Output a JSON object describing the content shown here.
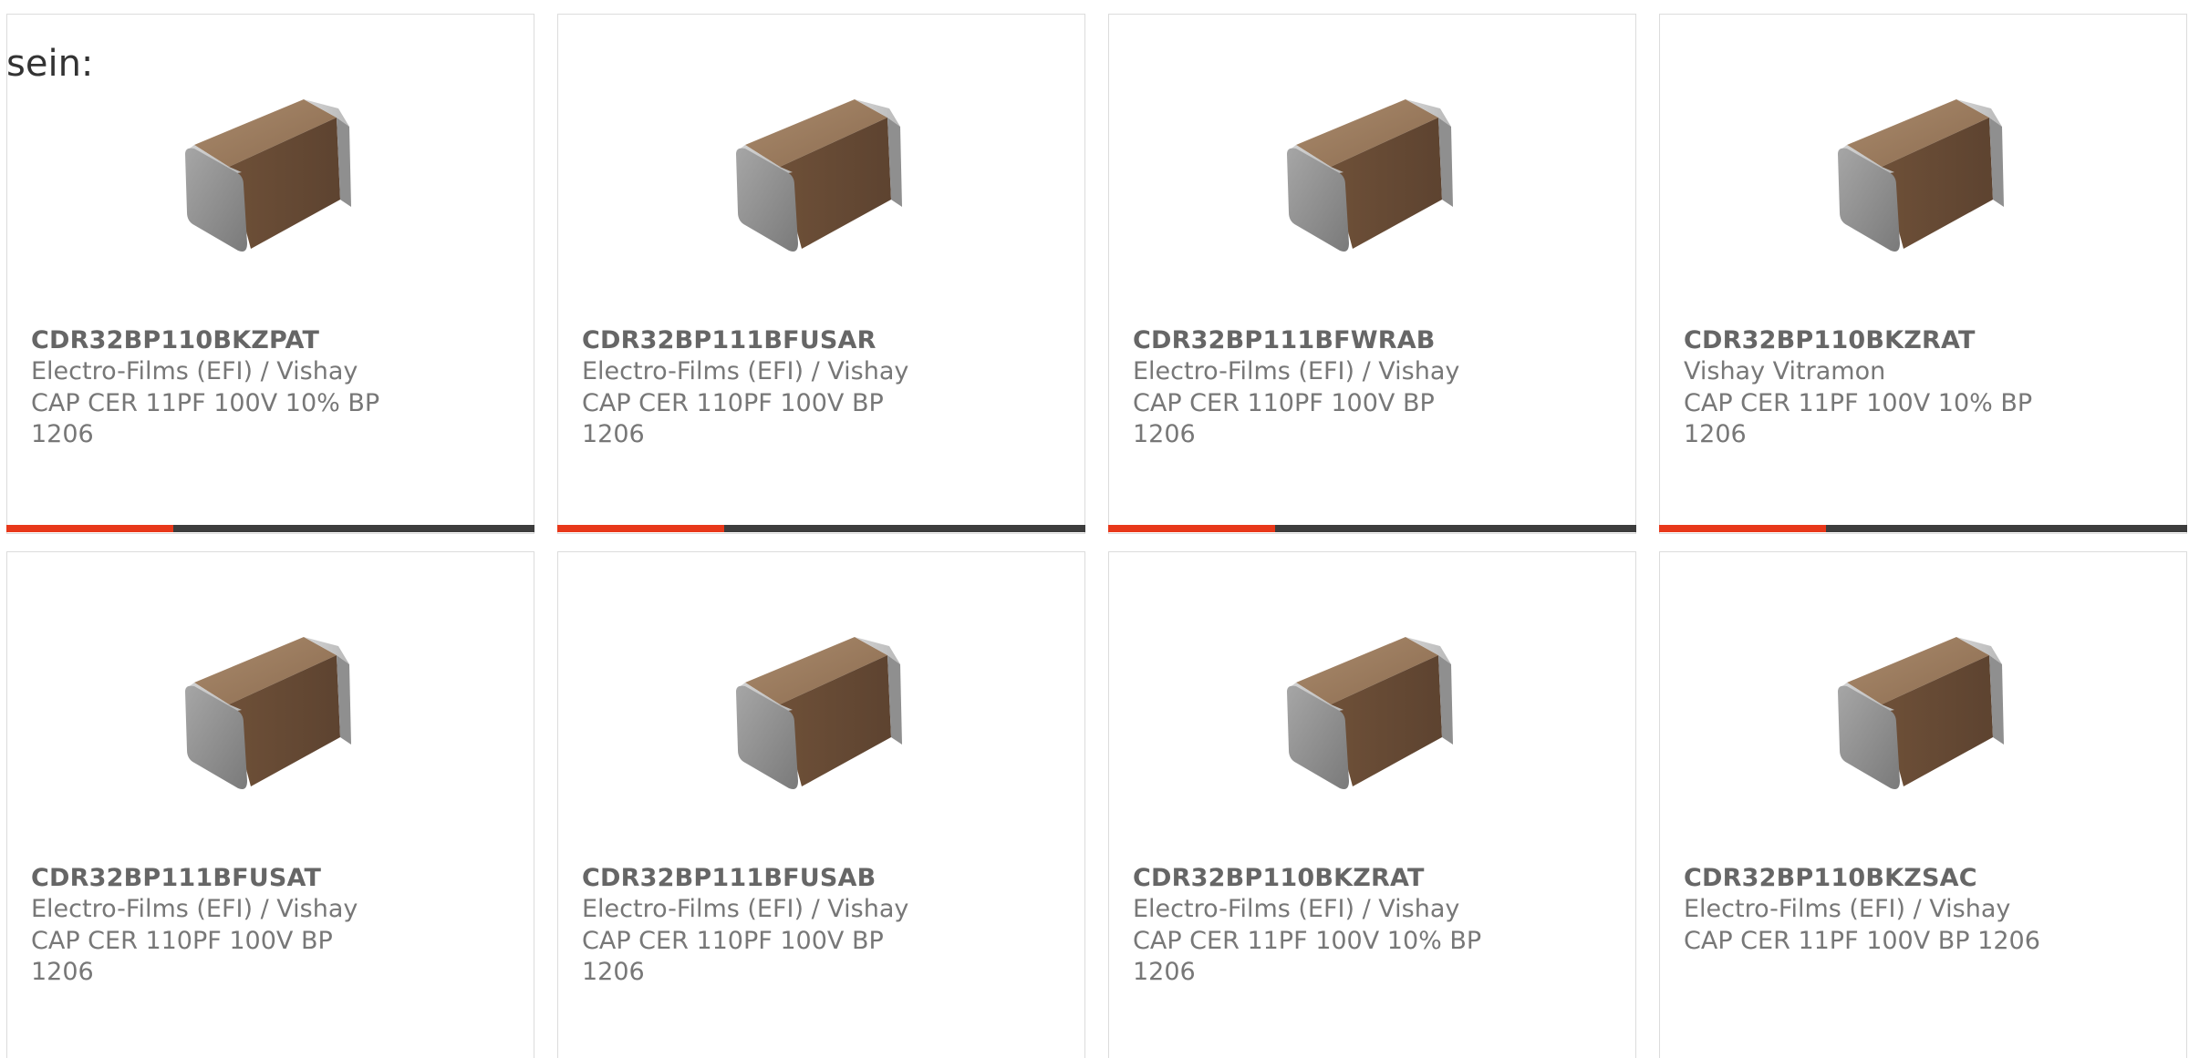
{
  "intro_text": "sein:",
  "colors": {
    "accent": "#e8381a",
    "bar": "#3d3d3d",
    "border": "#dcdcdc",
    "text": "#666666"
  },
  "products": [
    {
      "part": "CDR32BP110BKZPAT",
      "manufacturer": "Electro-Films (EFI) / Vishay",
      "description": "CAP CER 11PF 100V 10% BP 1206",
      "image": "ceramic-capacitor-chip-image"
    },
    {
      "part": "CDR32BP111BFUSAR",
      "manufacturer": "Electro-Films (EFI) / Vishay",
      "description": "CAP CER 110PF 100V BP 1206",
      "image": "ceramic-capacitor-chip-image"
    },
    {
      "part": "CDR32BP111BFWRAB",
      "manufacturer": "Electro-Films (EFI) / Vishay",
      "description": "CAP CER 110PF 100V BP 1206",
      "image": "ceramic-capacitor-chip-image"
    },
    {
      "part": "CDR32BP110BKZRAT",
      "manufacturer": "Vishay Vitramon",
      "description": "CAP CER 11PF 100V 10% BP 1206",
      "image": "ceramic-capacitor-chip-image"
    },
    {
      "part": "CDR32BP111BFUSAT",
      "manufacturer": "Electro-Films (EFI) / Vishay",
      "description": "CAP CER 110PF 100V BP 1206",
      "image": "ceramic-capacitor-chip-image"
    },
    {
      "part": "CDR32BP111BFUSAB",
      "manufacturer": "Electro-Films (EFI) / Vishay",
      "description": "CAP CER 110PF 100V BP 1206",
      "image": "ceramic-capacitor-chip-image"
    },
    {
      "part": "CDR32BP110BKZRAT",
      "manufacturer": "Electro-Films (EFI) / Vishay",
      "description": "CAP CER 11PF 100V 10% BP 1206",
      "image": "ceramic-capacitor-chip-image"
    },
    {
      "part": "CDR32BP110BKZSAC",
      "manufacturer": "Electro-Films (EFI) / Vishay",
      "description": "CAP CER 11PF 100V BP 1206",
      "image": "ceramic-capacitor-chip-image"
    }
  ]
}
